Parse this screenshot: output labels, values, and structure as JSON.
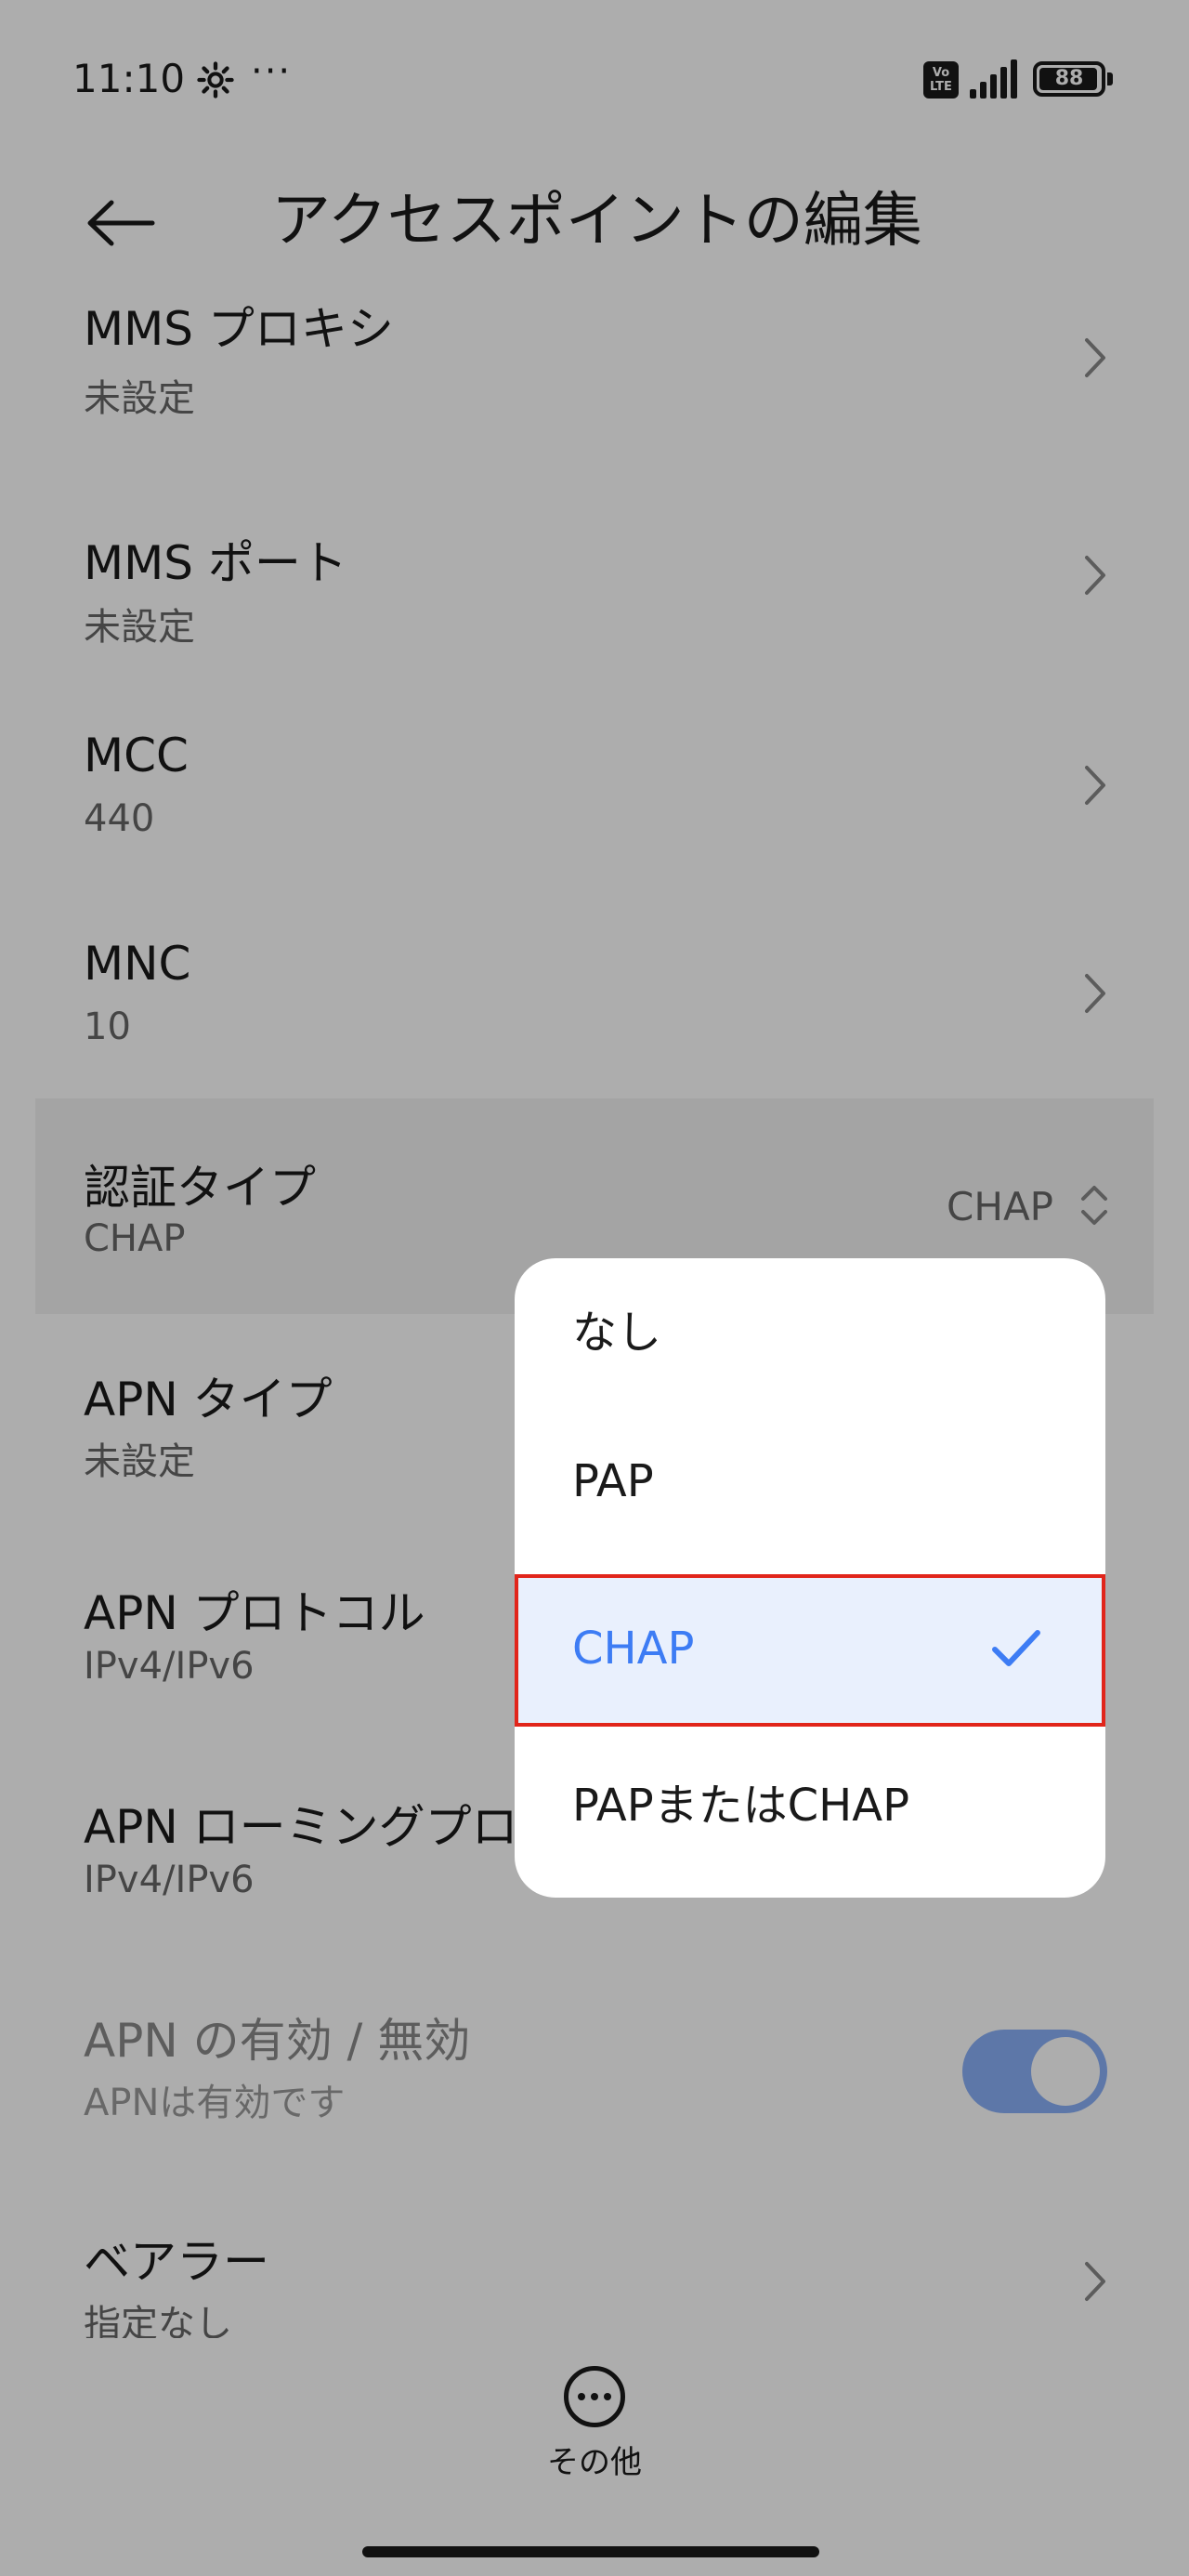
{
  "status_bar": {
    "time": "11:10",
    "more": "···",
    "volte": "Vo\nLTE",
    "battery": "88"
  },
  "header": {
    "title": "アクセスポイントの編集"
  },
  "list": {
    "items": [
      {
        "title": "MMS プロキシ",
        "sub": "未設定"
      },
      {
        "title": "MMS ポート",
        "sub": "未設定"
      },
      {
        "title": "MCC",
        "sub": "440"
      },
      {
        "title": "MNC",
        "sub": "10"
      },
      {
        "title": "認証タイプ",
        "sub": "CHAP",
        "value": "CHAP"
      },
      {
        "title": "APN タイプ",
        "sub": "未設定"
      },
      {
        "title": "APN プロトコル",
        "sub": "IPv4/IPv6"
      },
      {
        "title": "APN ローミングプロ",
        "sub": "IPv4/IPv6"
      },
      {
        "title": "APN の有効 / 無効",
        "sub": "APNは有効です",
        "toggle_on": true
      },
      {
        "title": "ベアラー",
        "sub": "指定なし"
      }
    ]
  },
  "popup": {
    "options": [
      {
        "label": "なし"
      },
      {
        "label": "PAP"
      },
      {
        "label": "CHAP",
        "selected": true
      },
      {
        "label": "PAPまたはCHAP"
      }
    ]
  },
  "bottom": {
    "more_label": "その他"
  },
  "colors": {
    "accent": "#3d7cf4",
    "selection_outline": "#e1251b",
    "selected_bg": "#e9f0fd"
  }
}
